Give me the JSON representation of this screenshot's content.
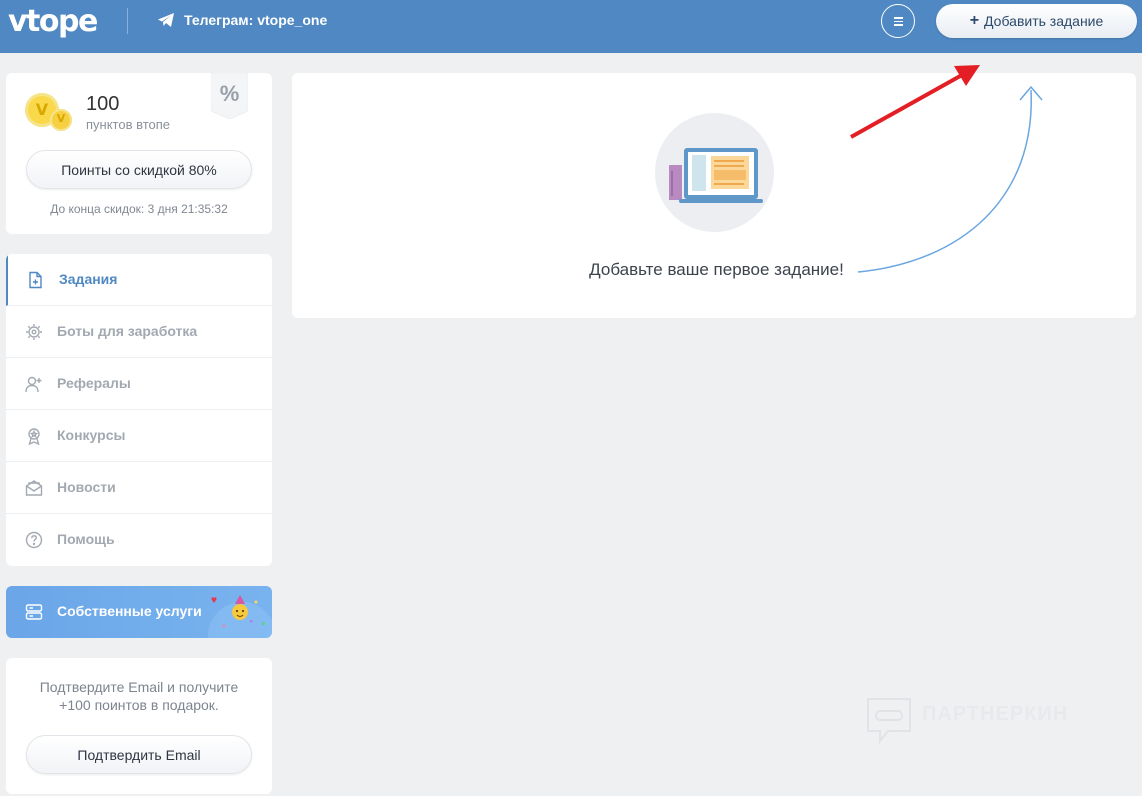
{
  "header": {
    "logo": "vtope",
    "telegram_label": "Телеграм: vtope_one",
    "add_task_label": "Добавить задание"
  },
  "points": {
    "value": "100",
    "label": "пунктов втопе",
    "discount_badge": "%",
    "discount_button": "Поинты со скидкой 80%",
    "countdown": "До конца скидок: 3 дня 21:35:32"
  },
  "sidebar": {
    "items": [
      {
        "label": "Задания",
        "icon": "task-icon",
        "active": true
      },
      {
        "label": "Боты для заработка",
        "icon": "bot-icon",
        "active": false
      },
      {
        "label": "Рефералы",
        "icon": "referral-icon",
        "active": false
      },
      {
        "label": "Конкурсы",
        "icon": "award-icon",
        "active": false
      },
      {
        "label": "Новости",
        "icon": "mail-icon",
        "active": false
      },
      {
        "label": "Помощь",
        "icon": "help-icon",
        "active": false
      }
    ]
  },
  "services": {
    "label": "Собственные услуги"
  },
  "email": {
    "text": "Подтвердите Email и получите +100 поинтов в подарок.",
    "button": "Подтвердить Email"
  },
  "main": {
    "empty_text": "Добавьте ваше первое задание!"
  },
  "watermark": {
    "label": "ПАРТНЕРКИН"
  },
  "colors": {
    "header": "#4f88c2",
    "accent": "#4f88c2",
    "arrow_red": "#e31e24",
    "services": "#6aa6e8"
  }
}
